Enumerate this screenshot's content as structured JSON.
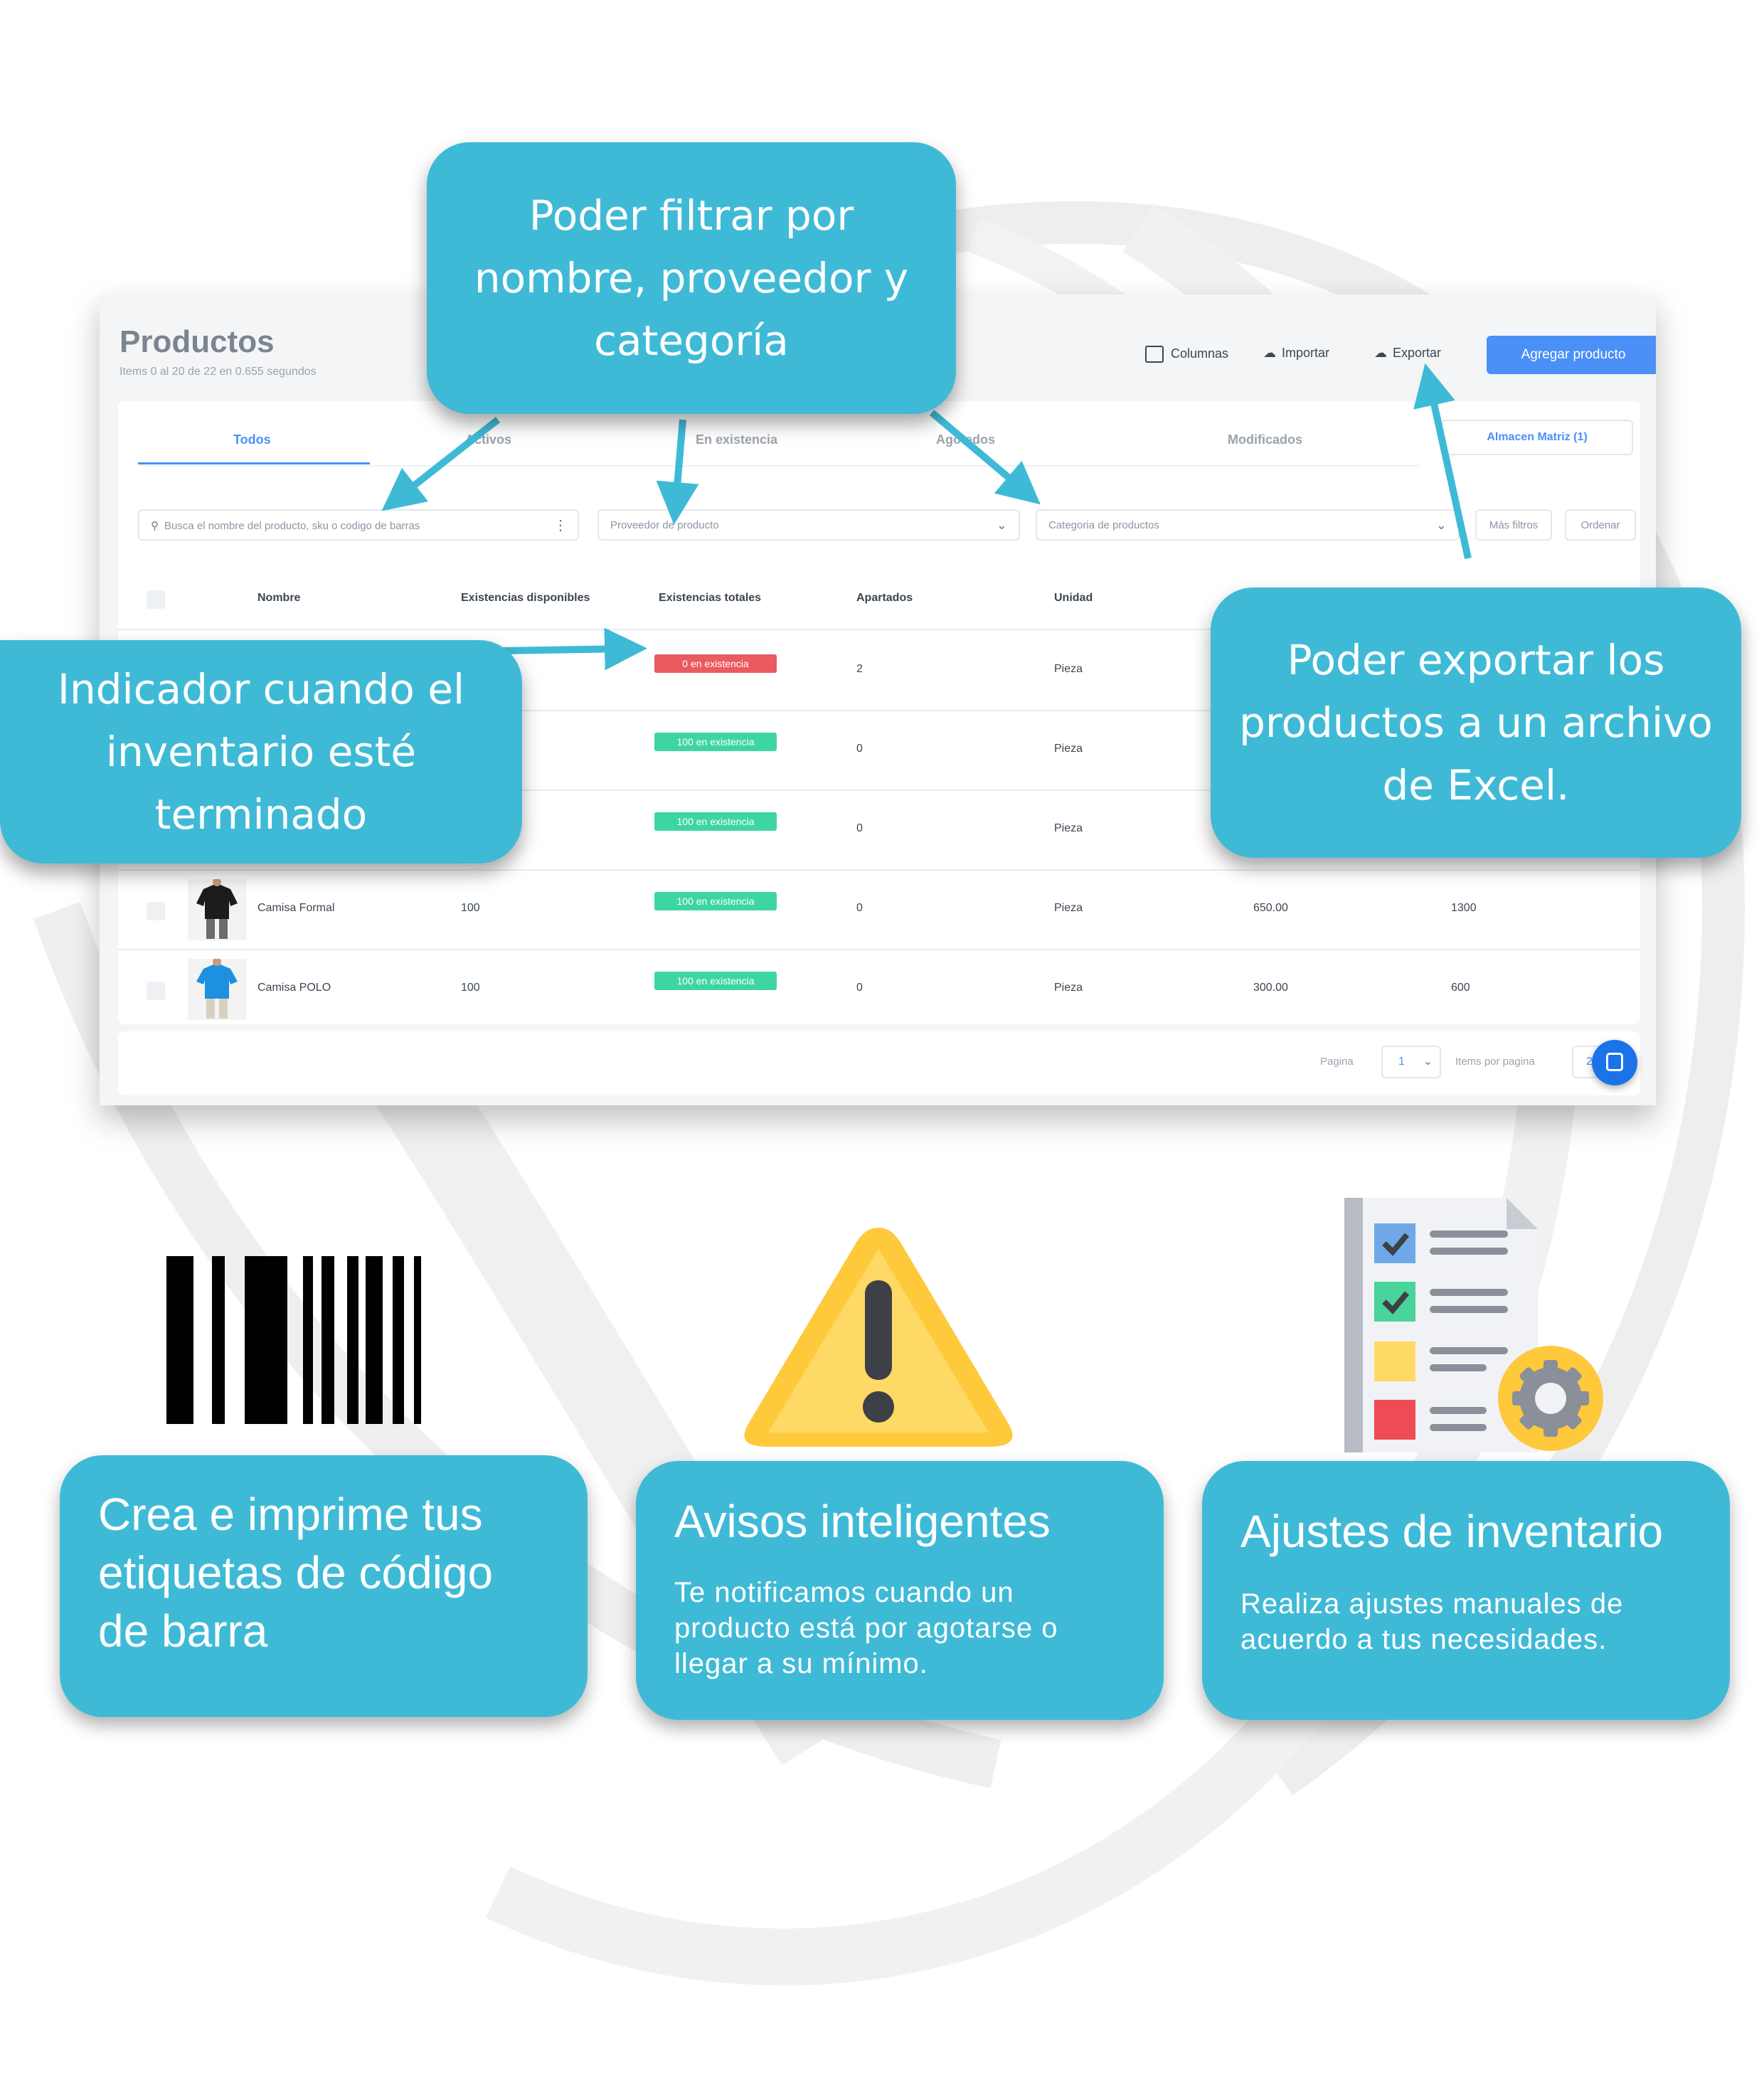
{
  "app": {
    "title": "Productos",
    "subtitle": "Items 0 al 20 de 22 en 0.655 segundos",
    "header_actions": {
      "columns": "Columnas",
      "import": "Importar",
      "export": "Exportar",
      "add": "Agregar producto"
    },
    "tabs": [
      "Todos",
      "Activos",
      "En existencia",
      "Agotados",
      "Modificados"
    ],
    "warehouse": "Almacen Matriz (1)",
    "search": {
      "placeholder": "Busca el nombre del producto, sku o codigo de barras"
    },
    "supplier_select": "Proveedor de producto",
    "category_select": "Categoria de productos",
    "more_filters": "Más filtros",
    "sort": "Ordenar",
    "columns": [
      "Nombre",
      "Existencias disponibles",
      "Existencias totales",
      "Apartados",
      "Unidad"
    ],
    "rows": [
      {
        "name": "",
        "available": "",
        "stock_badge": "0 en existencia",
        "stock_status": "out",
        "reserved": "2",
        "unit": "Pieza",
        "price": "",
        "total": ""
      },
      {
        "name": "",
        "available": "",
        "stock_badge": "100 en existencia",
        "stock_status": "in",
        "reserved": "0",
        "unit": "Pieza",
        "price": "",
        "total": ""
      },
      {
        "name": "",
        "available": "",
        "stock_badge": "100 en existencia",
        "stock_status": "in",
        "reserved": "0",
        "unit": "Pieza",
        "price": "",
        "total": ""
      },
      {
        "name": "Camisa Formal",
        "available": "100",
        "stock_badge": "100 en existencia",
        "stock_status": "in",
        "reserved": "0",
        "unit": "Pieza",
        "price": "650.00",
        "total": "1300"
      },
      {
        "name": "Camisa POLO",
        "available": "100",
        "stock_badge": "100 en existencia",
        "stock_status": "in",
        "reserved": "0",
        "unit": "Pieza",
        "price": "300.00",
        "total": "600"
      }
    ],
    "pagination": {
      "page_label": "Pagina",
      "page": "1",
      "per_page_label": "Items por pagina",
      "per_page": "20"
    }
  },
  "callouts": {
    "filter": [
      "Poder filtrar por",
      "nombre, proveedor y",
      "categoría"
    ],
    "indicator": [
      "Indicador cuando el",
      "inventario esté",
      "terminado"
    ],
    "export": [
      "Poder exportar los",
      "productos a un archivo",
      "de Excel."
    ]
  },
  "features": {
    "barcode": {
      "title_lines": [
        "Crea e imprime tus",
        "etiquetas de código",
        "de barra"
      ]
    },
    "alerts": {
      "title": "Avisos inteligentes",
      "body_lines": [
        "Te notificamos cuando un",
        "producto está por agotarse o",
        "llegar a su mínimo."
      ]
    },
    "adjust": {
      "title": "Ajustes de inventario",
      "body_lines": [
        "Realiza ajustes manuales de",
        "acuerdo a tus necesidades."
      ]
    }
  },
  "colors": {
    "accent": "#3fbad6",
    "primary_button": "#4a90f7",
    "badge_out": "#ea5a5f",
    "badge_in": "#3ed6a0"
  }
}
